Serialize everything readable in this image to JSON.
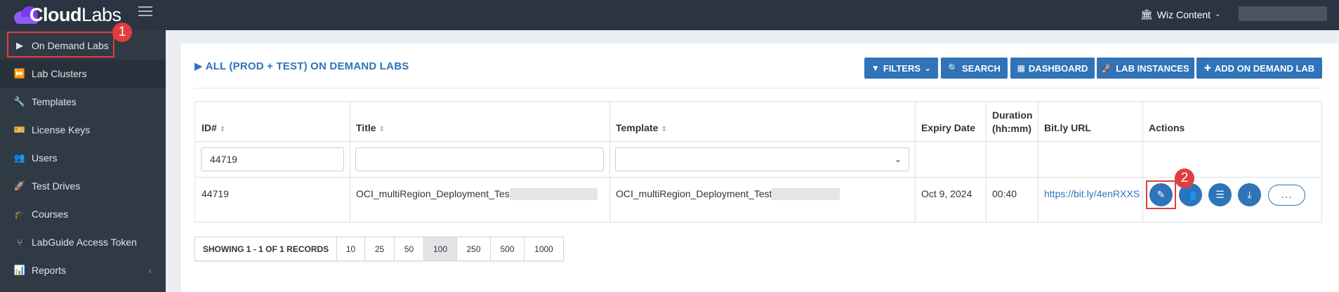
{
  "app": {
    "logo_bold": "Cloud",
    "logo_light": "Labs",
    "org_name": "Wiz Content"
  },
  "sidebar": {
    "items": [
      {
        "label": "On Demand Labs",
        "icon": "play-icon"
      },
      {
        "label": "Lab Clusters",
        "icon": "fast-forward-icon"
      },
      {
        "label": "Templates",
        "icon": "wrench-icon"
      },
      {
        "label": "License Keys",
        "icon": "ticket-icon"
      },
      {
        "label": "Users",
        "icon": "users-icon"
      },
      {
        "label": "Test Drives",
        "icon": "rocket-icon"
      },
      {
        "label": "Courses",
        "icon": "graduation-cap-icon"
      },
      {
        "label": "LabGuide Access Token",
        "icon": "code-fork-icon"
      },
      {
        "label": "Reports",
        "icon": "bar-chart-icon"
      }
    ]
  },
  "annotations": {
    "badge_1": "1",
    "badge_2": "2"
  },
  "panel": {
    "title": "ALL (PROD + TEST) ON DEMAND LABS",
    "buttons": {
      "filters": "FILTERS",
      "search": "SEARCH",
      "dashboard": "DASHBOARD",
      "lab_instances": "LAB INSTANCES",
      "add_lab": "ADD ON DEMAND LAB"
    }
  },
  "table": {
    "headers": {
      "id": "ID#",
      "title": "Title",
      "template": "Template",
      "expiry": "Expiry Date",
      "duration_line1": "Duration",
      "duration_line2": "(hh:mm)",
      "bitly": "Bit.ly URL",
      "actions": "Actions"
    },
    "filters": {
      "id_value": "44719",
      "title_value": "",
      "template_value": ""
    },
    "rows": [
      {
        "id": "44719",
        "title": "OCI_multiRegion_Deployment_Test",
        "template": "OCI_multiRegion_Deployment_Test",
        "expiry": "Oct 9, 2024",
        "duration": "00:40",
        "bitly": "https://bit.ly/4enRXXS",
        "more": "..."
      }
    ]
  },
  "pagination": {
    "info": "SHOWING 1 - 1 OF 1 RECORDS",
    "sizes": [
      "10",
      "25",
      "50",
      "100",
      "250",
      "500",
      "1000"
    ],
    "selected": "100"
  }
}
